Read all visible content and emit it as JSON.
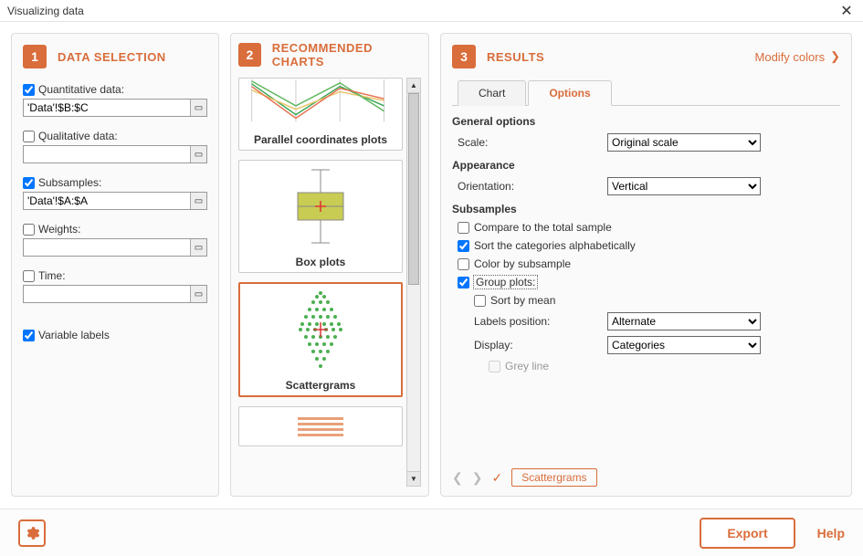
{
  "window": {
    "title": "Visualizing data"
  },
  "panel1": {
    "step": "1",
    "title": "DATA SELECTION",
    "quantitative": {
      "label": "Quantitative data:",
      "checked": true,
      "value": "'Data'!$B:$C"
    },
    "qualitative": {
      "label": "Qualitative data:",
      "checked": false,
      "value": ""
    },
    "subsamples": {
      "label": "Subsamples:",
      "checked": true,
      "value": "'Data'!$A:$A"
    },
    "weights": {
      "label": "Weights:",
      "checked": false,
      "value": ""
    },
    "time": {
      "label": "Time:",
      "checked": false,
      "value": ""
    },
    "varlabels": {
      "label": "Variable labels",
      "checked": true
    }
  },
  "panel2": {
    "step": "2",
    "title": "RECOMMENDED CHARTS",
    "cards": {
      "parallel": "Parallel coordinates plots",
      "box": "Box plots",
      "scatter": "Scattergrams"
    }
  },
  "panel3": {
    "step": "3",
    "title": "RESULTS",
    "modify": "Modify colors",
    "tabs": {
      "chart": "Chart",
      "options": "Options"
    },
    "sections": {
      "general": "General options",
      "scale_label": "Scale:",
      "scale_value": "Original scale",
      "appearance": "Appearance",
      "orientation_label": "Orientation:",
      "orientation_value": "Vertical",
      "subsamples": "Subsamples",
      "compare": "Compare to the total sample",
      "sort_alpha": "Sort the categories alphabetically",
      "color_by": "Color by subsample",
      "group_plots": "Group plots:",
      "sort_mean": "Sort by mean",
      "labels_pos_label": "Labels position:",
      "labels_pos_value": "Alternate",
      "display_label": "Display:",
      "display_value": "Categories",
      "grey_line": "Grey line"
    },
    "footer_chip": "Scattergrams"
  },
  "bottom": {
    "export": "Export",
    "help": "Help"
  }
}
